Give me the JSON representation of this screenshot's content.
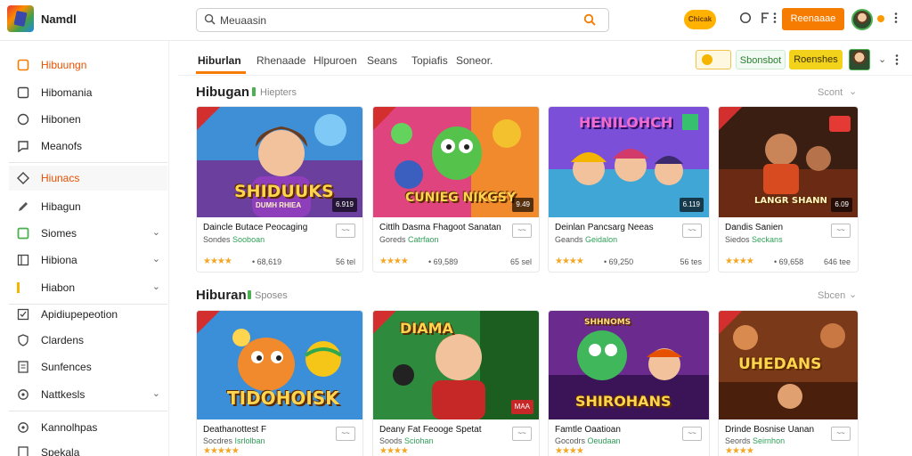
{
  "app": {
    "title": "Namdl"
  },
  "search": {
    "value": "Meuaasin",
    "placeholder": "Meuaasin"
  },
  "header": {
    "coin_label": "Chicak",
    "primary_button": "Reenaaae",
    "icons": [
      "circle-icon",
      "filter-icon",
      "more-vert-icon"
    ]
  },
  "sidebar": {
    "items": [
      {
        "label": "Hibuungn",
        "icon": "grid-icon",
        "active": true,
        "chevron": false
      },
      {
        "label": "Hibomania",
        "icon": "square-icon",
        "chevron": false
      },
      {
        "label": "Hibonen",
        "icon": "compass-icon",
        "chevron": false
      },
      {
        "label": "Meanofs",
        "icon": "chat-icon",
        "chevron": false
      },
      {
        "label": "Hiunacs",
        "icon": "diamond-icon",
        "highlight": true,
        "chevron": false
      },
      {
        "label": "Hibagun",
        "icon": "pen-icon",
        "chevron": false
      },
      {
        "label": "Siomes",
        "icon": "green-box-icon",
        "chevron": true
      },
      {
        "label": "Hibiona",
        "icon": "list-icon",
        "chevron": true
      },
      {
        "label": "Hiabon",
        "icon": "bar-icon",
        "chevron": true
      },
      {
        "label": "Apidiupepeotion",
        "icon": "check-box-icon",
        "chevron": false
      },
      {
        "label": "Clardens",
        "icon": "shield-icon",
        "chevron": false
      },
      {
        "label": "Sunfences",
        "icon": "doc-icon",
        "chevron": false
      },
      {
        "label": "Nattkesls",
        "icon": "gear-icon",
        "chevron": true
      },
      {
        "label": "Kannolhpas",
        "icon": "gear-icon",
        "chevron": false
      },
      {
        "label": "Spekala",
        "icon": "doc-icon",
        "chevron": false
      }
    ]
  },
  "subnav": {
    "tabs": [
      "Hiburlan",
      "Rhenaade",
      "Hlpuroen",
      "Seans",
      "Topiafis",
      "Soneor."
    ],
    "pills": {
      "pill1": "Sbonsbot",
      "pill2": "Roenshes"
    }
  },
  "sections": [
    {
      "title": "Hibugan",
      "subtitle": "Hiepters",
      "more": "Scont",
      "cards": [
        {
          "art_title": "SHIDUUKS",
          "art_sub": "DUMH RHIEA",
          "art_price": "6.919",
          "title": "Daincle Butace Peocaging",
          "dev": "Sondes",
          "dev2": "Sooboan",
          "stars": "★★★★",
          "count": "• 68,619",
          "price": "56 tel",
          "action": "~~"
        },
        {
          "art_title": "CUNIEG NIKGSY",
          "art_sub": "",
          "art_price": "9.49",
          "title": "Cittlh Dasma Fhagoot Sanatan",
          "dev": "Goreds",
          "dev2": "Catrfaon",
          "stars": "★★★★",
          "count": "• 69,589",
          "price": "65 sel",
          "action": "~~"
        },
        {
          "art_title": "HENILOHCH",
          "art_sub": "",
          "art_price": "6.119",
          "title": "Deinlan Pancsarg Neeas",
          "dev": "Geands",
          "dev2": "Geidalon",
          "stars": "★★★★",
          "count": "• 69,250",
          "price": "56 tes",
          "action": "~~"
        },
        {
          "art_title": "LANGR SHANN",
          "art_sub": "",
          "art_price": "6.09",
          "title": "Dandis Sanien",
          "dev": "Siedos",
          "dev2": "Seckans",
          "stars": "★★★★",
          "count": "• 69,658",
          "price": "646 tee",
          "action": "~~"
        }
      ]
    },
    {
      "title": "Hiburan",
      "subtitle": "Sposes",
      "more": "Sbcen",
      "cards": [
        {
          "art_title": "TIDOHOISK",
          "art_sub": "",
          "art_price": "",
          "title": "Deathanottest F",
          "dev": "Socdres",
          "dev2": "Isrlolban",
          "stars": "★★★★★",
          "count": "",
          "price": "",
          "action": "~~"
        },
        {
          "art_title": "DIAMA",
          "art_sub": "",
          "art_price": "MAA",
          "title": "Deany Fat Feooge Spetat",
          "dev": "Soods",
          "dev2": "Sciohan",
          "stars": "★★★★",
          "count": "",
          "price": "",
          "action": "~~"
        },
        {
          "art_title": "SHIROHANS",
          "art_sub": "SHHNOMS",
          "art_price": "",
          "title": "Famtle Oaatioan",
          "dev": "Gocodrs",
          "dev2": "Oeudaan",
          "stars": "★★★★",
          "count": "",
          "price": "",
          "action": "~~"
        },
        {
          "art_title": "UHEDANS",
          "art_sub": "",
          "art_price": "",
          "title": "Drinde Bosnise Uanan",
          "dev": "Seords",
          "dev2": "Seirnhon",
          "stars": "★★★★",
          "count": "",
          "price": "",
          "action": "~~"
        }
      ]
    }
  ],
  "colors": {
    "accent": "#f57c00",
    "green": "#4caf50",
    "pill_yellow": "#f6d11b"
  }
}
